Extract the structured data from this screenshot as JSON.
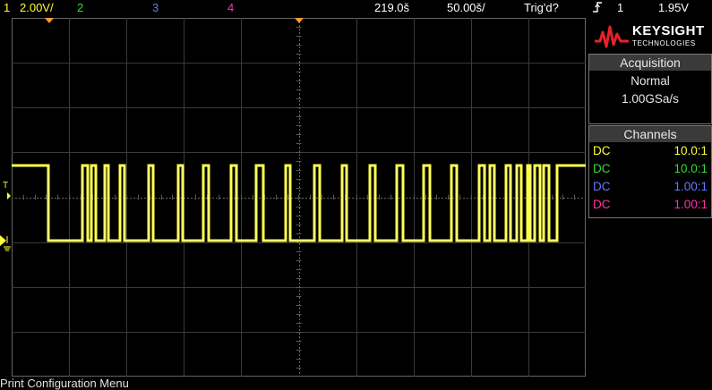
{
  "topbar": {
    "ch1_num": "1",
    "ch1_scale": "2.00V/",
    "ch2_num": "2",
    "ch3_num": "3",
    "ch4_num": "4",
    "timebase": "219.0š",
    "delay": "50.00š/",
    "trigger_status": "Trig'd?",
    "trigger_icon": "rising-edge-icon",
    "trigger_source": "1",
    "trigger_level": "1.95V"
  },
  "logo": {
    "brand": "KEYSIGHT",
    "sub": "TECHNOLOGIES"
  },
  "acquisition": {
    "title": "Acquisition",
    "mode": "Normal",
    "rate": "1.00GSa/s"
  },
  "channels": {
    "title": "Channels",
    "rows": [
      {
        "coupling": "DC",
        "probe": "10.0:1",
        "color": "#ffff33"
      },
      {
        "coupling": "DC",
        "probe": "10.0:1",
        "color": "#33dd33"
      },
      {
        "coupling": "DC",
        "probe": "1.00:1",
        "color": "#6677ff"
      },
      {
        "coupling": "DC",
        "probe": "1.00:1",
        "color": "#ff33aa"
      }
    ]
  },
  "status_text": "Print Configuration Menu",
  "trace_color": "#ffff33"
}
